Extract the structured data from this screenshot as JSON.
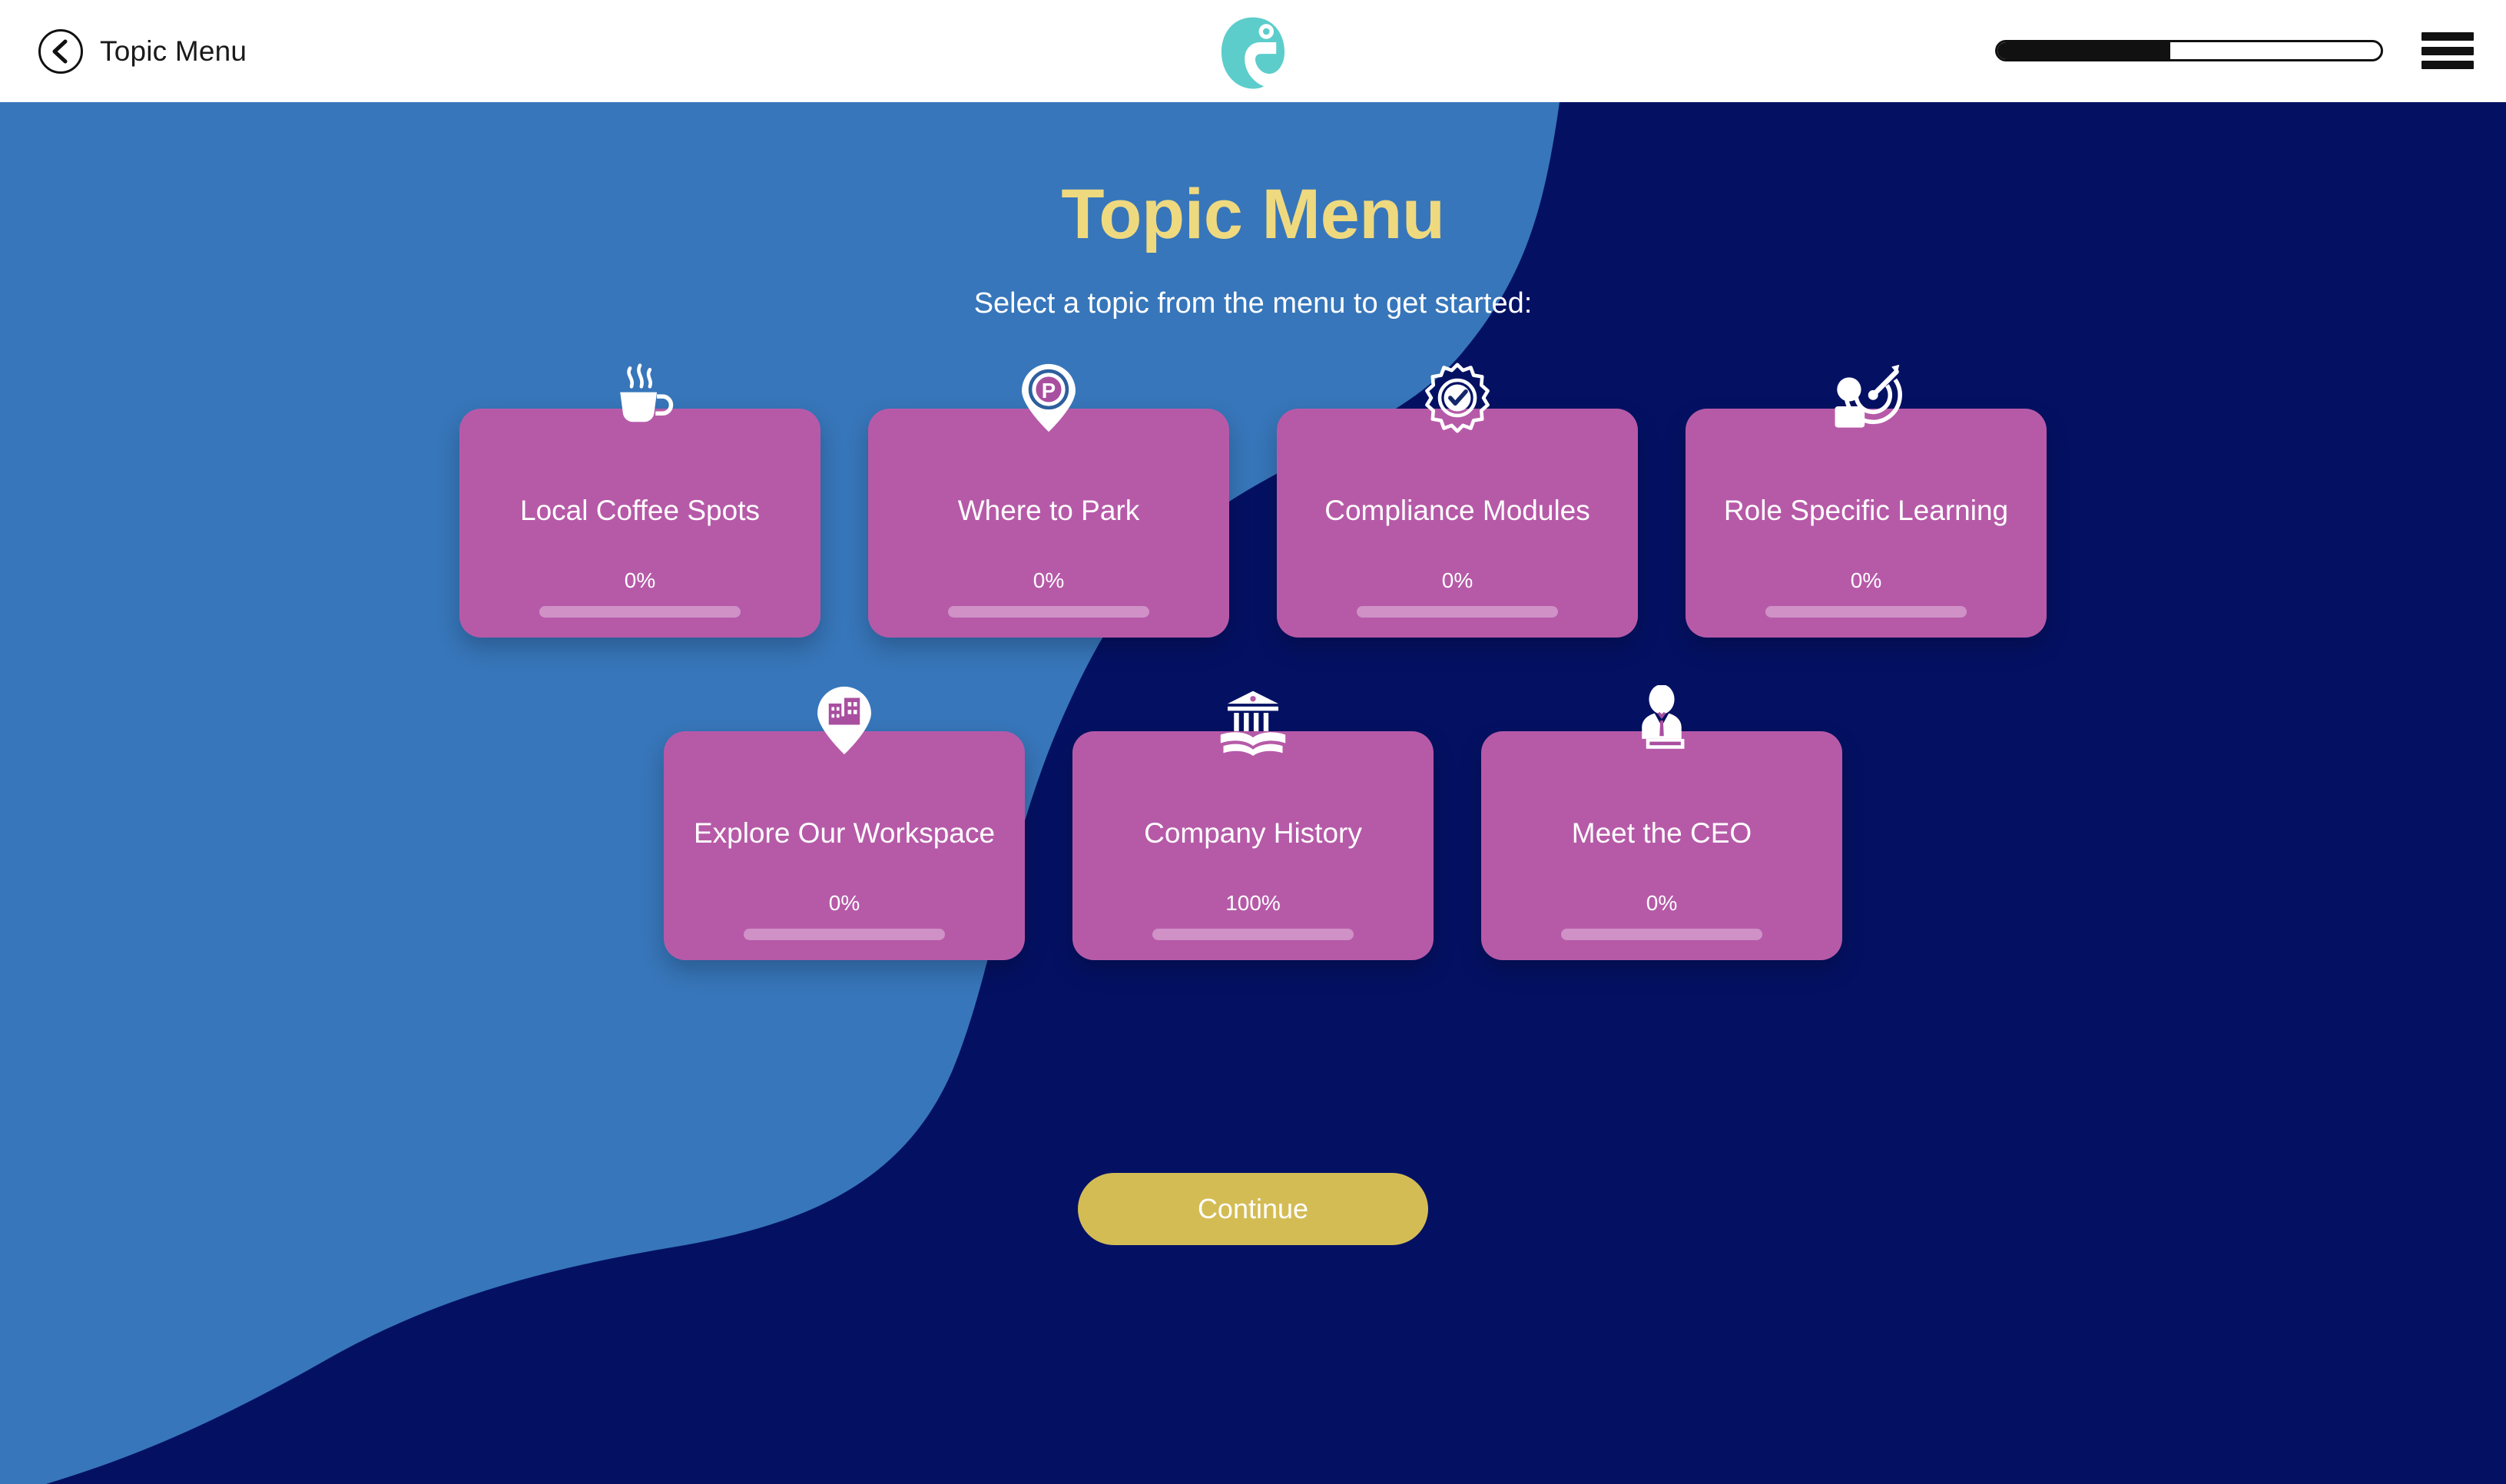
{
  "header": {
    "back_label": "Topic Menu",
    "back_icon": "chevron-left-icon",
    "logo_icon": "chameleon-logo",
    "progress_percent": 45,
    "menu_icon": "hamburger-menu-icon"
  },
  "main": {
    "title": "Topic Menu",
    "subtitle": "Select a topic from the menu to get started:",
    "continue_label": "Continue",
    "cards_row1": [
      {
        "label": "Local Coffee Spots",
        "percent_text": "0%",
        "percent": 0,
        "icon": "coffee-cup-icon"
      },
      {
        "label": "Where to Park",
        "percent_text": "0%",
        "percent": 0,
        "icon": "parking-pin-icon"
      },
      {
        "label": "Compliance Modules",
        "percent_text": "0%",
        "percent": 0,
        "icon": "gear-check-icon"
      },
      {
        "label": "Role Specific Learning",
        "percent_text": "0%",
        "percent": 0,
        "icon": "person-target-icon"
      }
    ],
    "cards_row2": [
      {
        "label": "Explore Our Workspace",
        "percent_text": "0%",
        "percent": 0,
        "icon": "building-pin-icon"
      },
      {
        "label": "Company History",
        "percent_text": "100%",
        "percent": 100,
        "icon": "museum-book-icon"
      },
      {
        "label": "Meet the CEO",
        "percent_text": "0%",
        "percent": 0,
        "icon": "businessman-podium-icon"
      }
    ]
  },
  "colors": {
    "background_blue": "#3776ba",
    "background_navy": "#041163",
    "card_pink": "#b65aa8",
    "title_yellow": "#efd97f",
    "button_gold": "#d4bc55",
    "logo_teal": "#5ccdcb"
  }
}
